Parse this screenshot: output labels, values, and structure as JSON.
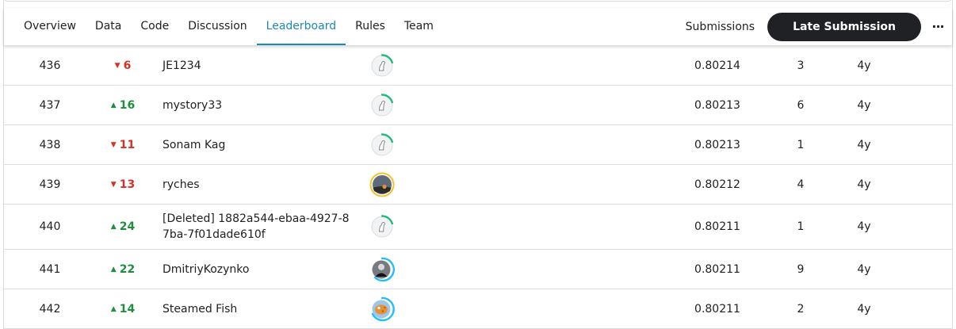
{
  "tabs": [
    {
      "label": "Overview",
      "active": false
    },
    {
      "label": "Data",
      "active": false
    },
    {
      "label": "Code",
      "active": false
    },
    {
      "label": "Discussion",
      "active": false
    },
    {
      "label": "Leaderboard",
      "active": true
    },
    {
      "label": "Rules",
      "active": false
    },
    {
      "label": "Team",
      "active": false
    }
  ],
  "actions": {
    "submissions_label": "Submissions",
    "late_submission_label": "Late Submission",
    "more_label": "···"
  },
  "accent_color": "#1a8bb3",
  "up_color": "#1e8e3e",
  "down_color": "#d93025",
  "rows": [
    {
      "rank": "436",
      "direction": "down",
      "change": "6",
      "team": "JE1234",
      "avatar": "default-avatar",
      "score": "0.80214",
      "entries": "3",
      "last": "4y"
    },
    {
      "rank": "437",
      "direction": "up",
      "change": "16",
      "team": "mystory33",
      "avatar": "default-avatar",
      "score": "0.80213",
      "entries": "6",
      "last": "4y"
    },
    {
      "rank": "438",
      "direction": "down",
      "change": "11",
      "team": "Sonam Kag",
      "avatar": "default-avatar",
      "score": "0.80213",
      "entries": "1",
      "last": "4y"
    },
    {
      "rank": "439",
      "direction": "down",
      "change": "13",
      "team": "ryches",
      "avatar": "photo-sunset-avatar",
      "score": "0.80212",
      "entries": "4",
      "last": "4y"
    },
    {
      "rank": "440",
      "direction": "up",
      "change": "24",
      "team": "[Deleted] 1882a544-ebaa-4927-87ba-7f01dade610f",
      "avatar": "default-avatar",
      "score": "0.80211",
      "entries": "1",
      "last": "4y"
    },
    {
      "rank": "441",
      "direction": "up",
      "change": "22",
      "team": "DmitriyKozynko",
      "avatar": "photo-person-avatar",
      "score": "0.80211",
      "entries": "9",
      "last": "4y"
    },
    {
      "rank": "442",
      "direction": "up",
      "change": "14",
      "team": "Steamed Fish",
      "avatar": "fish-avatar",
      "score": "0.80211",
      "entries": "2",
      "last": "4y"
    }
  ]
}
